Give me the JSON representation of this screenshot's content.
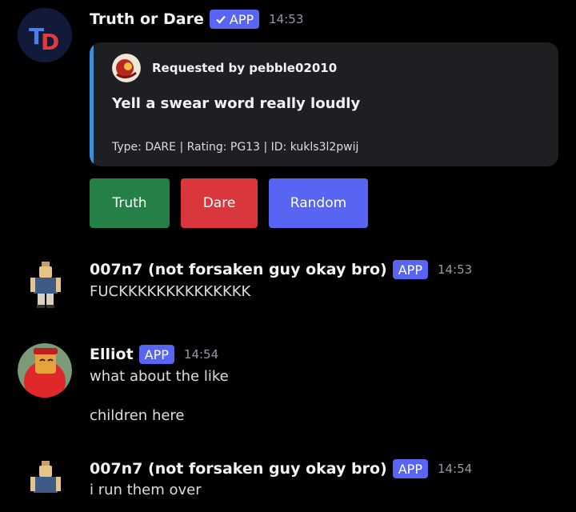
{
  "messages": [
    {
      "username": "Truth or Dare",
      "badge": "APP",
      "time": "14:53",
      "avatar_text": "TD",
      "embed": {
        "author": "Requested by pebble02010",
        "description": "Yell a swear word really loudly",
        "footer": "Type: DARE | Rating: PG13 | ID: kukls3l2pwij",
        "accent_color": "#3b8fd4"
      },
      "buttons": [
        {
          "label": "Truth",
          "color": "#248046"
        },
        {
          "label": "Dare",
          "color": "#da373c"
        },
        {
          "label": "Random",
          "color": "#5865f2"
        }
      ]
    },
    {
      "username": "007n7 (not forsaken guy okay bro)",
      "badge": "APP",
      "time": "14:53",
      "lines": [
        "FUCKKKKKKKKKKKKKK"
      ]
    },
    {
      "username": "Elliot",
      "badge": "APP",
      "time": "14:54",
      "lines": [
        "what about the like",
        "children here"
      ]
    },
    {
      "username": "007n7 (not forsaken guy okay bro)",
      "badge": "APP",
      "time": "14:54",
      "lines": [
        "i run them over"
      ]
    }
  ],
  "colors": {
    "background": "#000000",
    "badge": "#5865f2",
    "timestamp": "#949ba4"
  }
}
